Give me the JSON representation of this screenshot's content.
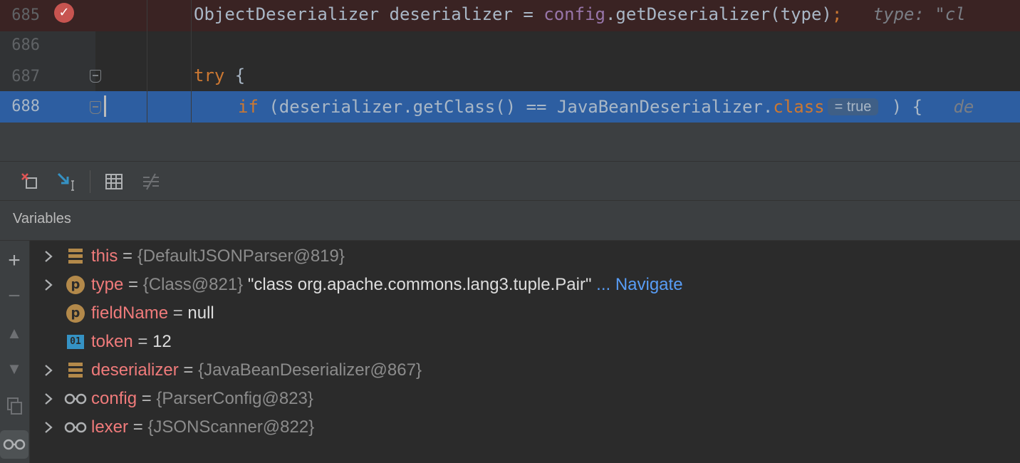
{
  "editor": {
    "lines": [
      {
        "num": "685",
        "code": "ObjectDeserializer deserializer = ",
        "field": "config",
        "rest": ".getDeserializer(type)",
        "semi": ";",
        "inline_hint": "type: \"cl"
      },
      {
        "num": "686"
      },
      {
        "num": "687",
        "kw": "try",
        "rest": " {"
      },
      {
        "num": "688",
        "kw": "if",
        "mid": " (deserializer.getClass() == JavaBeanDeserializer.",
        "kw2": "class",
        "tooltip": "= true",
        "rest": " ) {",
        "inline_hint": "de"
      }
    ]
  },
  "toolbar": {
    "buttons": [
      "clear-breakpoints-icon",
      "step-into-icon",
      "evaluate-table-icon",
      "compare-icon"
    ]
  },
  "variables": {
    "title": "Variables",
    "rows": [
      {
        "name": "this",
        "sep": " = ",
        "ref": "{DefaultJSONParser@819}",
        "icon": "field-icon",
        "expandable": true
      },
      {
        "name": "type",
        "sep": " = ",
        "ref": "{Class@821}",
        "str": " \"class org.apache.commons.lang3.tuple.Pair\"",
        "link": " ... Navigate",
        "icon": "parameter-icon",
        "expandable": true
      },
      {
        "name": "fieldName",
        "sep": " = ",
        "str": "null",
        "icon": "parameter-icon",
        "expandable": false
      },
      {
        "name": "token",
        "sep": " = ",
        "str": "12",
        "icon": "primitive-icon",
        "expandable": false
      },
      {
        "name": "deserializer",
        "sep": " = ",
        "ref": "{JavaBeanDeserializer@867}",
        "icon": "field-icon",
        "expandable": true
      },
      {
        "name": "config",
        "sep": " = ",
        "ref": "{ParserConfig@823}",
        "icon": "watch-icon",
        "expandable": true
      },
      {
        "name": "lexer",
        "sep": " = ",
        "ref": "{JSONScanner@822}",
        "icon": "watch-icon",
        "expandable": true
      }
    ]
  },
  "colors": {
    "background": "#2b2b2b",
    "exec_line": "#2d5ea1",
    "keyword": "#cc7832",
    "var_name": "#f07b7b",
    "link": "#589df6"
  }
}
